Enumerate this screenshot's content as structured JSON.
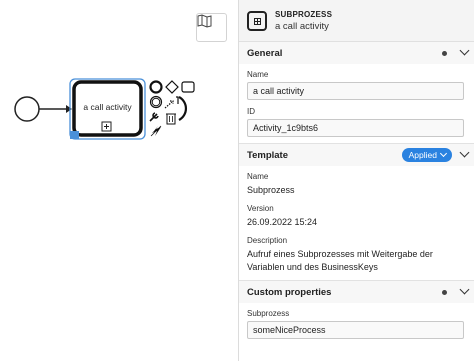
{
  "canvas": {
    "task_label": "a call activity",
    "minimap_icon": "map-icon",
    "context_pad": [
      "end-event-icon",
      "gateway-icon",
      "task-icon",
      "intermediate-event-icon",
      "connect-icon",
      "text-annotation-icon",
      "wrench-icon",
      "trash-icon",
      "lightning-icon"
    ],
    "selection_color": "#4a90d9"
  },
  "panel": {
    "header": {
      "type": "SUBPROZESS",
      "name": "a call activity",
      "icon": "subprocess-icon"
    },
    "general": {
      "title": "General",
      "name_label": "Name",
      "name_value": "a call activity",
      "id_label": "ID",
      "id_value": "Activity_1c9bts6"
    },
    "template": {
      "title": "Template",
      "badge": "Applied",
      "badge_color": "#2a82e0",
      "name_label": "Name",
      "name_value": "Subprozess",
      "version_label": "Version",
      "version_value": "26.09.2022 15:24",
      "description_label": "Description",
      "description_line1": "Aufruf eines Subprozesses mit Weitergabe der",
      "description_line2": "Variablen und des BusinessKeys"
    },
    "custom": {
      "title": "Custom properties",
      "field_label": "Subprozess",
      "field_value": "someNiceProcess"
    }
  }
}
